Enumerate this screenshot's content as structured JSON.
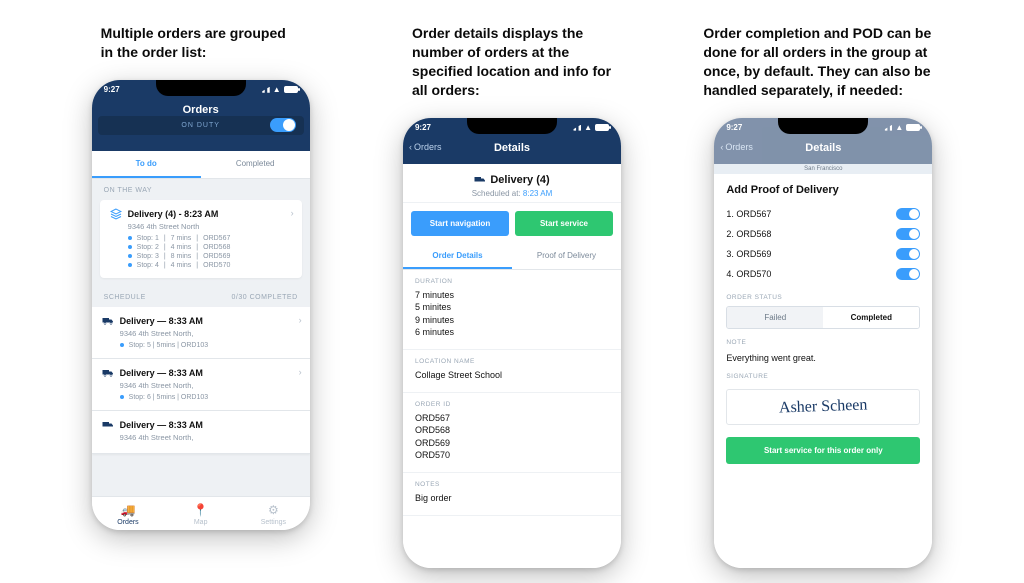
{
  "captions": {
    "c1": "Multiple orders are grouped in the order list:",
    "c2": "Order details displays the number of orders at the specified location and info for all orders:",
    "c3": "Order completion and POD can be done for all orders in the group at once, by default. They can also be handled separately, if needed:"
  },
  "status": {
    "time": "9:27"
  },
  "p1": {
    "title": "Orders",
    "duty": "ON DUTY",
    "tabs": {
      "todo": "To do",
      "completed": "Completed"
    },
    "on_the_way": "ON THE WAY",
    "group": {
      "headline": "Delivery (4) - 8:23 AM",
      "address": "9346 4th Street North",
      "stops": [
        {
          "label": "Stop: 1",
          "mins": "7 mins",
          "ord": "ORD567"
        },
        {
          "label": "Stop: 2",
          "mins": "4 mins",
          "ord": "ORD568"
        },
        {
          "label": "Stop: 3",
          "mins": "8 mins",
          "ord": "ORD569"
        },
        {
          "label": "Stop: 4",
          "mins": "4 mins",
          "ord": "ORD570"
        }
      ]
    },
    "schedule_label": "SCHEDULE",
    "schedule_count": "0/30 COMPLETED",
    "schedule": [
      {
        "headline": "Delivery — 8:33 AM",
        "address": "9346 4th Street North,",
        "info": "Stop: 5  |  5mins  |  ORD103"
      },
      {
        "headline": "Delivery — 8:33 AM",
        "address": "9346 4th Street North,",
        "info": "Stop: 6  |  5mins  |  ORD103"
      },
      {
        "headline": "Delivery — 8:33 AM",
        "address": "9346 4th Street North,"
      }
    ],
    "tabbar": {
      "orders": "Orders",
      "map": "Map",
      "settings": "Settings"
    }
  },
  "p2": {
    "back": "Orders",
    "title": "Details",
    "head_title": "Delivery (4)",
    "sched_prefix": "Scheduled at:",
    "sched_time": "8:23 AM",
    "btn_nav": "Start navigation",
    "btn_start": "Start service",
    "subtabs": {
      "details": "Order Details",
      "pod": "Proof of Delivery"
    },
    "duration_label": "DURATION",
    "durations": [
      "7 minutes",
      "5 minites",
      "9 minutes",
      "6 minutes"
    ],
    "location_label": "LOCATION NAME",
    "location_value": "Collage Street School",
    "orderid_label": "ORDER ID",
    "orderids": [
      "ORD567",
      "ORD568",
      "ORD569",
      "ORD570"
    ],
    "notes_label": "NOTES",
    "notes_value": "Big order"
  },
  "p3": {
    "back": "Orders",
    "title": "Details",
    "map_city": "San Francisco",
    "sheet_title": "Add Proof of Delivery",
    "items": [
      {
        "n": "1.",
        "id": "ORD567"
      },
      {
        "n": "2.",
        "id": "ORD568"
      },
      {
        "n": "3.",
        "id": "ORD569"
      },
      {
        "n": "4.",
        "id": "ORD570"
      }
    ],
    "status_label": "ORDER STATUS",
    "seg_failed": "Failed",
    "seg_completed": "Completed",
    "note_label": "NOTE",
    "note_value": "Everything went great.",
    "sig_label": "SIGNATURE",
    "sig_text": "Asher Scheen",
    "action": "Start service for this order only"
  }
}
